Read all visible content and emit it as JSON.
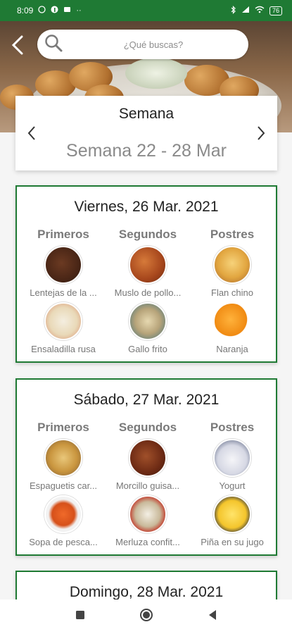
{
  "status_bar": {
    "time": "8:09",
    "battery": "76",
    "left_icons": [
      "whatsapp-icon",
      "facebook-icon",
      "mail-icon",
      "more-dots-icon"
    ],
    "right_icons": [
      "bluetooth-icon",
      "signal-icon",
      "wifi-icon"
    ]
  },
  "header": {
    "search_placeholder": "¿Qué buscas?"
  },
  "week": {
    "title": "Semana",
    "range": "Semana 22  - 28 Mar"
  },
  "days": [
    {
      "title": "Viernes, 26 Mar. 2021",
      "headers": [
        "Primeros",
        "Segundos",
        "Postres"
      ],
      "dishes": [
        {
          "name": "Lentejas de la ...",
          "icon": "lentils-dish-image"
        },
        {
          "name": "Muslo de pollo...",
          "icon": "chicken-dish-image"
        },
        {
          "name": "Flan chino",
          "icon": "flan-dish-image"
        },
        {
          "name": "Ensaladilla rusa",
          "icon": "russian-salad-dish-image"
        },
        {
          "name": "Gallo frito",
          "icon": "fried-fish-dish-image"
        },
        {
          "name": "Naranja",
          "icon": "orange-dish-image"
        }
      ]
    },
    {
      "title": "Sábado, 27 Mar. 2021",
      "headers": [
        "Primeros",
        "Segundos",
        "Postres"
      ],
      "dishes": [
        {
          "name": "Espaguetis car...",
          "icon": "spaghetti-dish-image"
        },
        {
          "name": "Morcillo guisa...",
          "icon": "stew-dish-image"
        },
        {
          "name": "Yogurt",
          "icon": "yogurt-dish-image"
        },
        {
          "name": "Sopa de pesca...",
          "icon": "fish-soup-dish-image"
        },
        {
          "name": "Merluza confit...",
          "icon": "hake-dish-image"
        },
        {
          "name": "Piña en su jugo",
          "icon": "pineapple-dish-image"
        }
      ]
    },
    {
      "title": "Domingo, 28 Mar. 2021"
    }
  ],
  "colors": {
    "accent_green": "#1f7a34",
    "heading_gray": "#7a7a7a",
    "text_gray": "#777777"
  }
}
